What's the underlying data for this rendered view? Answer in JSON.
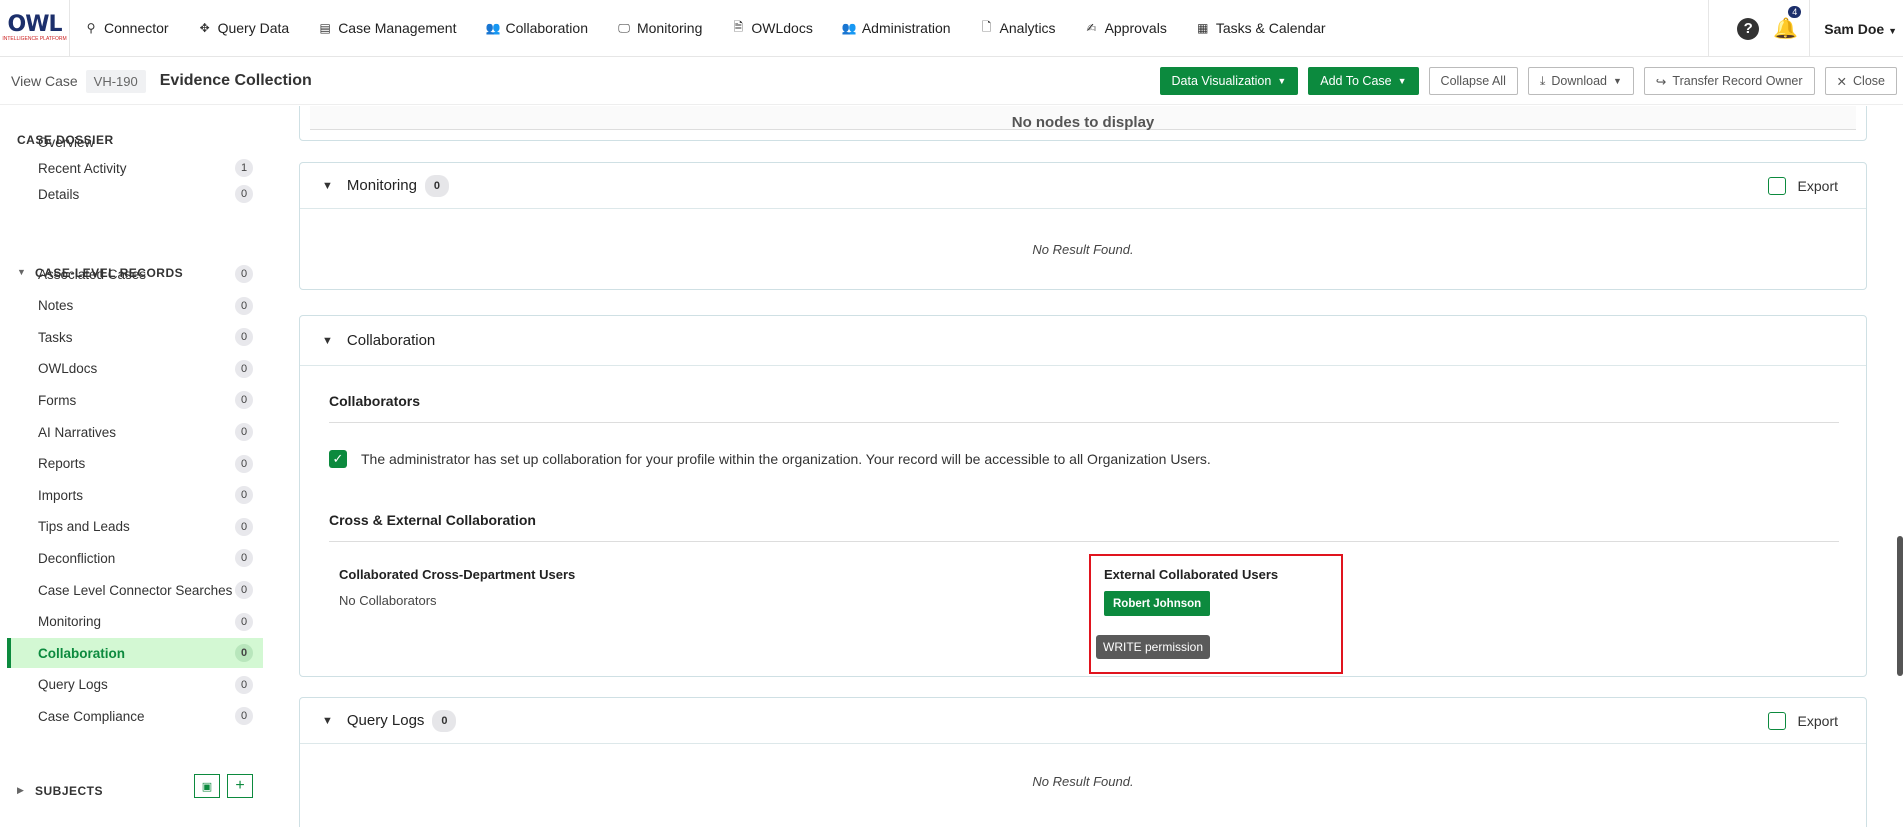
{
  "nav": {
    "logo_text": "OWL",
    "logo_sub": "INTELLIGENCE PLATFORM",
    "items": [
      {
        "label": "Connector",
        "icon": "search-icon",
        "glyph": "⚲"
      },
      {
        "label": "Query Data",
        "icon": "move-icon",
        "glyph": "✥"
      },
      {
        "label": "Case Management",
        "icon": "case-file-icon",
        "glyph": "▤"
      },
      {
        "label": "Collaboration",
        "icon": "users-icon",
        "glyph": "👥"
      },
      {
        "label": "Monitoring",
        "icon": "monitor-icon",
        "glyph": "🖵"
      },
      {
        "label": "OWLdocs",
        "icon": "docs-icon",
        "glyph": "🗎"
      },
      {
        "label": "Administration",
        "icon": "admin-users-icon",
        "glyph": "👥"
      },
      {
        "label": "Analytics",
        "icon": "file-icon",
        "glyph": "🗋"
      },
      {
        "label": "Approvals",
        "icon": "approval-icon",
        "glyph": "✍"
      },
      {
        "label": "Tasks & Calendar",
        "icon": "calendar-icon",
        "glyph": "▦"
      }
    ],
    "help_glyph": "?",
    "notifications_count": "4",
    "user_name": "Sam Doe"
  },
  "subheader": {
    "view_case_label": "View Case",
    "case_id": "VH-190",
    "case_title": "Evidence Collection",
    "buttons": {
      "data_visualization": "Data Visualization",
      "add_to_case": "Add To Case",
      "collapse_all": "Collapse All",
      "download": "Download",
      "transfer": "Transfer Record Owner",
      "close": "Close"
    }
  },
  "sidebar": {
    "dossier_heading": "CASE DOSSIER",
    "dossier_items": [
      {
        "label": "Overview",
        "count": ""
      },
      {
        "label": "Recent Activity",
        "count": "1"
      },
      {
        "label": "Details",
        "count": "0"
      }
    ],
    "records_heading": "CASE-LEVEL RECORDS",
    "record_items": [
      {
        "label": "Associated Cases",
        "count": "0"
      },
      {
        "label": "Notes",
        "count": "0"
      },
      {
        "label": "Tasks",
        "count": "0"
      },
      {
        "label": "OWLdocs",
        "count": "0"
      },
      {
        "label": "Forms",
        "count": "0"
      },
      {
        "label": "AI Narratives",
        "count": "0"
      },
      {
        "label": "Reports",
        "count": "0"
      },
      {
        "label": "Imports",
        "count": "0"
      },
      {
        "label": "Tips and Leads",
        "count": "0"
      },
      {
        "label": "Deconfliction",
        "count": "0"
      },
      {
        "label": "Case Level Connector Searches",
        "count": "0"
      },
      {
        "label": "Monitoring",
        "count": "0"
      },
      {
        "label": "Collaboration",
        "count": "0",
        "active": true
      },
      {
        "label": "Query Logs",
        "count": "0"
      },
      {
        "label": "Case Compliance",
        "count": "0"
      }
    ],
    "subjects_heading": "SUBJECTS"
  },
  "main": {
    "nodes_empty": "No nodes to display",
    "monitoring": {
      "title": "Monitoring",
      "count": "0",
      "export": "Export",
      "empty": "No Result Found."
    },
    "collaboration": {
      "title": "Collaboration",
      "collaborators_heading": "Collaborators",
      "org_notice": "The administrator has set up collaboration for your profile within the organization. Your record will be accessible to all Organization Users.",
      "cross_heading": "Cross & External Collaboration",
      "cross_dept_heading": "Collaborated Cross-Department Users",
      "cross_dept_empty": "No Collaborators",
      "external_heading": "External Collaborated Users",
      "external_user": "Robert Johnson",
      "permission_tooltip": "WRITE permission"
    },
    "query_logs": {
      "title": "Query Logs",
      "count": "0",
      "export": "Export",
      "empty": "No Result Found."
    }
  },
  "colors": {
    "accent": "#0c8a3e",
    "highlight": "#e0141e",
    "active_bg": "#d3f8d3"
  }
}
